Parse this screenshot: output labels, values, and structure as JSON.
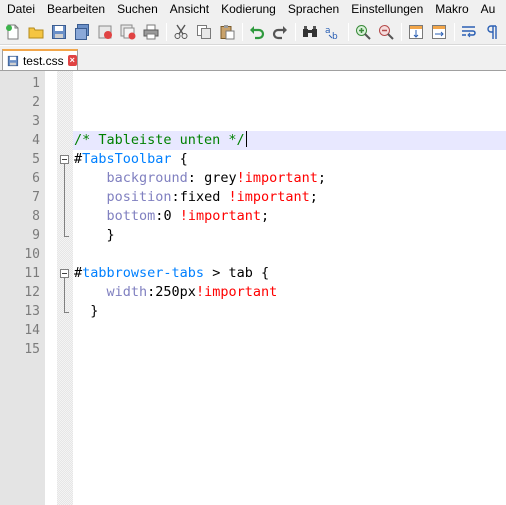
{
  "menu": [
    "Datei",
    "Bearbeiten",
    "Suchen",
    "Ansicht",
    "Kodierung",
    "Sprachen",
    "Einstellungen",
    "Makro",
    "Au"
  ],
  "toolbar": {
    "buttons": [
      "new-file",
      "open-file",
      "save",
      "save-all",
      "close",
      "close-all",
      "print",
      "cut",
      "copy",
      "paste",
      "undo",
      "redo",
      "find",
      "replace",
      "zoom-in",
      "zoom-out",
      "sync-vertical",
      "sync-horizontal",
      "word-wrap",
      "show-all-chars"
    ]
  },
  "tab": {
    "label": "test.css",
    "close": "×"
  },
  "editor": {
    "line_numbers": [
      "1",
      "2",
      "3",
      "4",
      "5",
      "6",
      "7",
      "8",
      "9",
      "10",
      "11",
      "12",
      "13",
      "14",
      "15"
    ],
    "lines": [
      {
        "parts": []
      },
      {
        "parts": []
      },
      {
        "parts": []
      },
      {
        "parts": [
          {
            "t": "/* Tableiste unten */",
            "c": "c-comment"
          }
        ]
      },
      {
        "parts": [
          {
            "t": "#",
            "c": "c-hash"
          },
          {
            "t": "TabsToolbar",
            "c": "c-id"
          },
          {
            "t": " {",
            "c": "c-op"
          }
        ]
      },
      {
        "parts": [
          {
            "t": "    ",
            "c": ""
          },
          {
            "t": "background",
            "c": "c-prop"
          },
          {
            "t": ": ",
            "c": "c-op"
          },
          {
            "t": "grey",
            "c": "c-val"
          },
          {
            "t": "!important",
            "c": "c-imp"
          },
          {
            "t": ";",
            "c": "c-op"
          }
        ]
      },
      {
        "parts": [
          {
            "t": "    ",
            "c": ""
          },
          {
            "t": "position",
            "c": "c-prop"
          },
          {
            "t": ":",
            "c": "c-op"
          },
          {
            "t": "fixed ",
            "c": "c-val"
          },
          {
            "t": "!important",
            "c": "c-imp"
          },
          {
            "t": ";",
            "c": "c-op"
          }
        ]
      },
      {
        "parts": [
          {
            "t": "    ",
            "c": ""
          },
          {
            "t": "bottom",
            "c": "c-prop"
          },
          {
            "t": ":",
            "c": "c-op"
          },
          {
            "t": "0 ",
            "c": "c-val"
          },
          {
            "t": "!important",
            "c": "c-imp"
          },
          {
            "t": ";",
            "c": "c-op"
          }
        ]
      },
      {
        "parts": [
          {
            "t": "    }",
            "c": "c-op"
          }
        ]
      },
      {
        "parts": []
      },
      {
        "parts": [
          {
            "t": "#",
            "c": "c-hash"
          },
          {
            "t": "tabbrowser-tabs",
            "c": "c-id"
          },
          {
            "t": " > tab {",
            "c": "c-op"
          }
        ]
      },
      {
        "parts": [
          {
            "t": "    ",
            "c": ""
          },
          {
            "t": "width",
            "c": "c-prop"
          },
          {
            "t": ":",
            "c": "c-op"
          },
          {
            "t": "250px",
            "c": "c-val"
          },
          {
            "t": "!important",
            "c": "c-imp"
          }
        ]
      },
      {
        "parts": [
          {
            "t": "  }",
            "c": "c-op"
          }
        ]
      },
      {
        "parts": []
      },
      {
        "parts": []
      }
    ]
  }
}
